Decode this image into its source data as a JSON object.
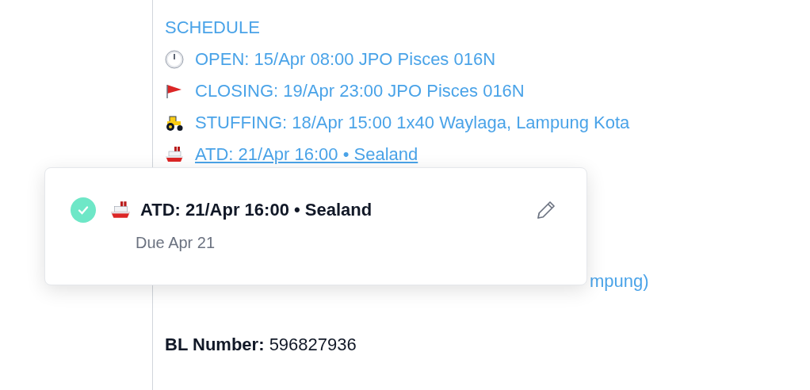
{
  "schedule": {
    "heading": "SCHEDULE",
    "items": [
      {
        "kind": "clock",
        "text": "OPEN: 15/Apr 08:00 JPO Pisces 016N",
        "underlined": false
      },
      {
        "kind": "flag",
        "text": "CLOSING: 19/Apr 23:00 JPO Pisces 016N",
        "underlined": false
      },
      {
        "kind": "tractor",
        "text": "STUFFING: 18/Apr 15:00 1x40 Waylaga, Lampung Kota",
        "underlined": false
      },
      {
        "kind": "ship",
        "text": "ATD: 21/Apr 16:00 • Sealand",
        "underlined": true
      }
    ]
  },
  "partial_line": {
    "text": "mpung)"
  },
  "bl_number": {
    "label": "BL Number:",
    "value": "596827936"
  },
  "popover": {
    "checked": true,
    "kind": "ship",
    "title": "ATD: 21/Apr 16:00 • Sealand",
    "due": "Due Apr 21"
  }
}
